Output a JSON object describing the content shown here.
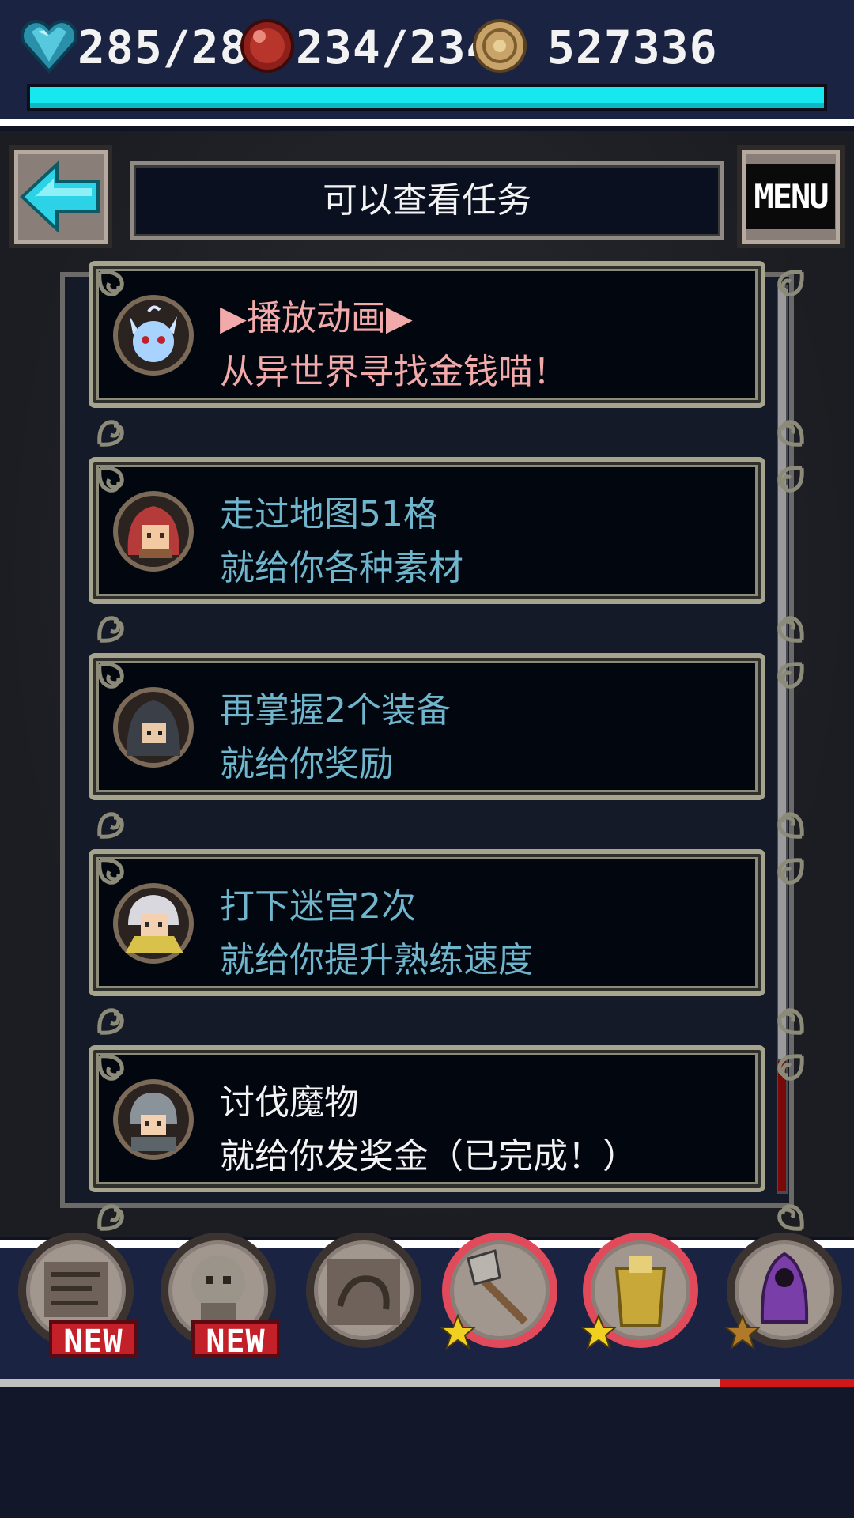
{
  "status": {
    "hp_text": "285/285",
    "mp_text": "234/234",
    "gold_text": "527336",
    "hp_fill_fraction": 1.0
  },
  "header": {
    "title": "可以查看任务",
    "menu_label": "MENU"
  },
  "quests": [
    {
      "line1": "▶播放动画▶",
      "line2": "从异世界寻找金钱喵！",
      "color": "#f2a9a9",
      "portrait": "blue-cat-spirit-icon"
    },
    {
      "line1": "走过地图51格",
      "line2": "就给你各种素材",
      "color": "#6fb6cc",
      "portrait": "red-hood-girl-icon"
    },
    {
      "line1": "再掌握2个装备",
      "line2": "就给你奖励",
      "color": "#6fb6cc",
      "portrait": "dark-hood-figure-icon"
    },
    {
      "line1": "打下迷宫2次",
      "line2": "就给你提升熟练速度",
      "color": "#6fb6cc",
      "portrait": "white-haired-elder-icon"
    },
    {
      "line1": "讨伐魔物",
      "line2": "就给你发奖金（已完成！）",
      "color": "#f3f3f3",
      "portrait": "armored-soldier-icon"
    }
  ],
  "bottom_slots": [
    {
      "icon": "scroll-map-icon",
      "badge": "NEW"
    },
    {
      "icon": "skull-mask-icon",
      "badge": "NEW"
    },
    {
      "icon": "sleeping-creature-icon",
      "badge": ""
    },
    {
      "icon": "battle-axe-icon",
      "badge": ""
    },
    {
      "icon": "golden-armor-icon",
      "badge": ""
    },
    {
      "icon": "purple-robe-icon",
      "badge": ""
    }
  ],
  "colors": {
    "accent_cyan": "#17e8ef",
    "highlight_pink": "#f2a9a9",
    "quest_blue": "#6fb6cc",
    "badge_red": "#c3202a"
  }
}
